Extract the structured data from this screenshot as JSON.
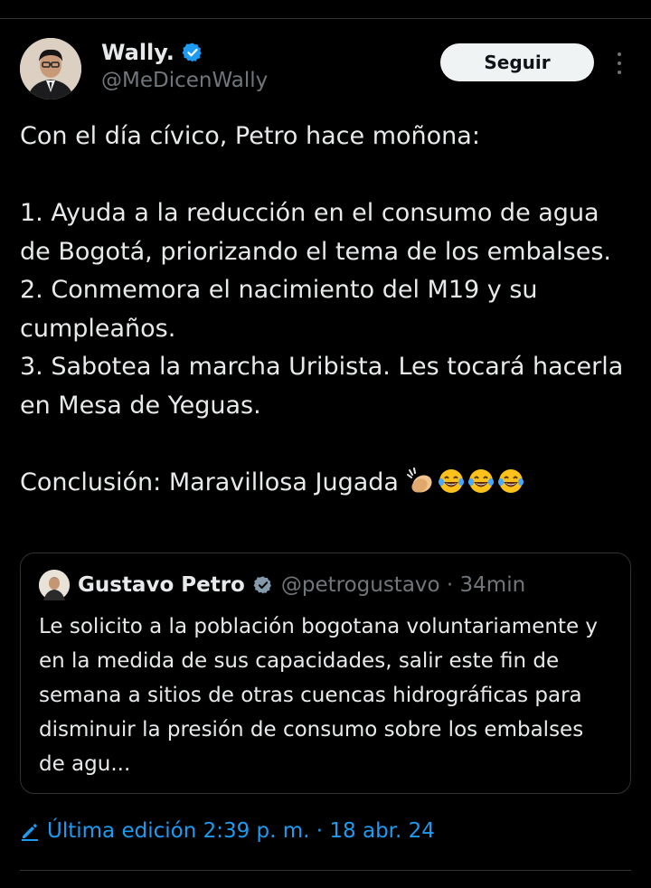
{
  "author": {
    "name": "Wally.",
    "handle": "@MeDicenWally",
    "verified_icon": "verified-badge-icon",
    "avatar_icon": "profile-photo"
  },
  "actions": {
    "follow_label": "Seguir",
    "more_icon": "more-vertical-icon"
  },
  "tweet": {
    "text": "Con el día cívico, Petro hace moñona:\n\n1. Ayuda a la reducción en el consumo de agua de Bogotá, priorizando el tema de los embalses.\n2. Conmemora el nacimiento del M19 y su cumpleaños.\n3. Sabotea la marcha Uribista. Les tocará hacerla en Mesa de Yeguas.\n\nConclusión: Maravillosa Jugada",
    "emojis": [
      "clapping-hands-emoji",
      "tears-of-joy-emoji",
      "tears-of-joy-emoji",
      "tears-of-joy-emoji"
    ]
  },
  "quote": {
    "name": "Gustavo Petro",
    "handle": "@petrogustavo · 34min",
    "text": "Le solicito a la población bogotana voluntariamente y en la medida de sus capacidades, salir este fin de semana a sitios de otras cuencas hidrográficas para disminuir la presión de consumo sobre los embalses de agu..."
  },
  "edit": {
    "label": "Última edición 2:39 p. m. · 18 abr. 24",
    "icon": "pencil-icon"
  },
  "colors": {
    "background": "#000000",
    "text": "#e7e9ea",
    "secondary": "#71767b",
    "accent": "#1d9bf0",
    "border": "#2f3336"
  }
}
